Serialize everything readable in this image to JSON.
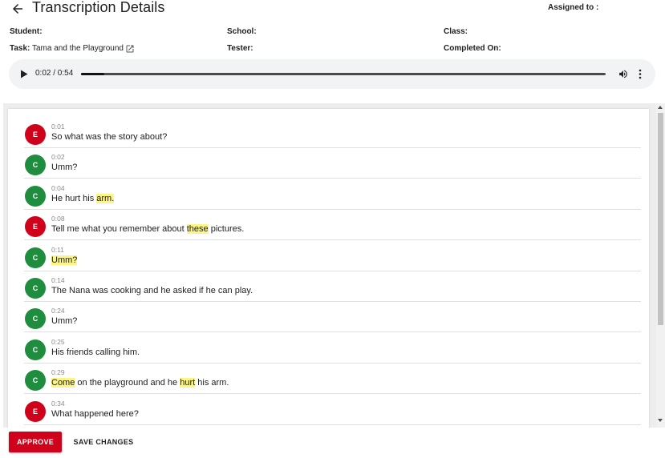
{
  "header": {
    "title": "Transcription Details",
    "assigned_label": "Assigned to :"
  },
  "meta": {
    "student_label": "Student:",
    "school_label": "School:",
    "class_label": "Class:",
    "task_label": "Task:",
    "task_value": "Tama and the Playground",
    "tester_label": "Tester:",
    "completed_label": "Completed On:"
  },
  "player": {
    "time": "0:02 / 0:54",
    "progress_fraction": 0.045
  },
  "colors": {
    "examiner": "#d0021b",
    "child": "#1e8e3e",
    "highlight": "#fbf587",
    "approve": "#d0021b"
  },
  "utterances": [
    {
      "speaker": "E",
      "time": "0:01",
      "segments": [
        {
          "t": "So what was the story about?"
        }
      ]
    },
    {
      "speaker": "C",
      "time": "0:02",
      "segments": [
        {
          "t": "Umm?"
        }
      ]
    },
    {
      "speaker": "C",
      "time": "0:04",
      "segments": [
        {
          "t": "He hurt his "
        },
        {
          "t": "arm.",
          "hl": true
        }
      ]
    },
    {
      "speaker": "E",
      "time": "0:08",
      "segments": [
        {
          "t": "Tell me what you remember about "
        },
        {
          "t": "these",
          "hl": true
        },
        {
          "t": " pictures."
        }
      ]
    },
    {
      "speaker": "C",
      "time": "0:11",
      "segments": [
        {
          "t": "Umm?",
          "hl": true
        }
      ]
    },
    {
      "speaker": "C",
      "time": "0:14",
      "segments": [
        {
          "t": "The Nana was cooking and he asked if he can play."
        }
      ]
    },
    {
      "speaker": "C",
      "time": "0:24",
      "segments": [
        {
          "t": "Umm?"
        }
      ]
    },
    {
      "speaker": "C",
      "time": "0:25",
      "segments": [
        {
          "t": "His friends calling him."
        }
      ]
    },
    {
      "speaker": "C",
      "time": "0:29",
      "segments": [
        {
          "t": "Come",
          "hl": true
        },
        {
          "t": " on the playground and he "
        },
        {
          "t": "hurt",
          "hl": true
        },
        {
          "t": " his arm."
        }
      ]
    },
    {
      "speaker": "E",
      "time": "0:34",
      "segments": [
        {
          "t": "What happened here?"
        }
      ]
    }
  ],
  "footer": {
    "approve_label": "APPROVE",
    "save_label": "SAVE CHANGES"
  }
}
